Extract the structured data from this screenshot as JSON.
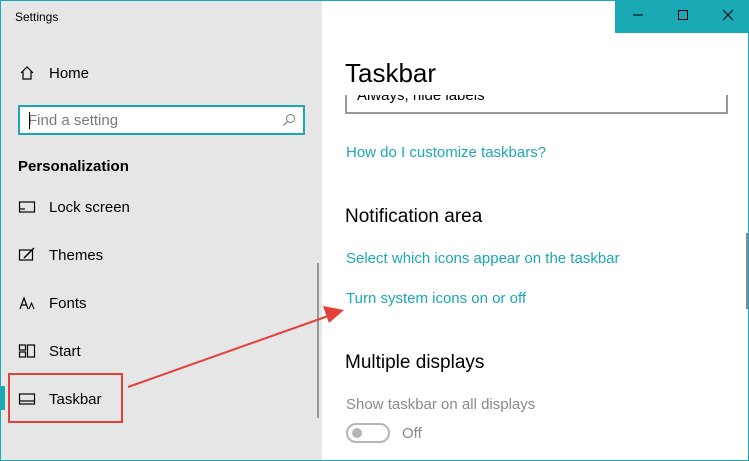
{
  "app": {
    "title": "Settings"
  },
  "sidebar": {
    "home_label": "Home",
    "search": {
      "placeholder": "Find a setting"
    },
    "section_label": "Personalization",
    "items": [
      {
        "label": "Lock screen",
        "icon": "lock-screen-icon"
      },
      {
        "label": "Themes",
        "icon": "themes-icon"
      },
      {
        "label": "Fonts",
        "icon": "fonts-icon"
      },
      {
        "label": "Start",
        "icon": "start-icon"
      },
      {
        "label": "Taskbar",
        "icon": "taskbar-icon",
        "selected": true
      }
    ]
  },
  "main": {
    "page_title": "Taskbar",
    "dropdown_value": "Always, hide labels",
    "customize_link": "How do I customize taskbars?",
    "notification": {
      "heading": "Notification area",
      "link_select_icons": "Select which icons appear on the taskbar",
      "link_system_icons": "Turn system icons on or off"
    },
    "multiple_displays": {
      "heading": "Multiple displays",
      "show_taskbar_label": "Show taskbar on all displays",
      "toggle_state": "Off"
    }
  },
  "colors": {
    "accent": "#1aa8b4",
    "annotation": "#e3403a",
    "sidebar_bg": "#e6e6e6"
  }
}
